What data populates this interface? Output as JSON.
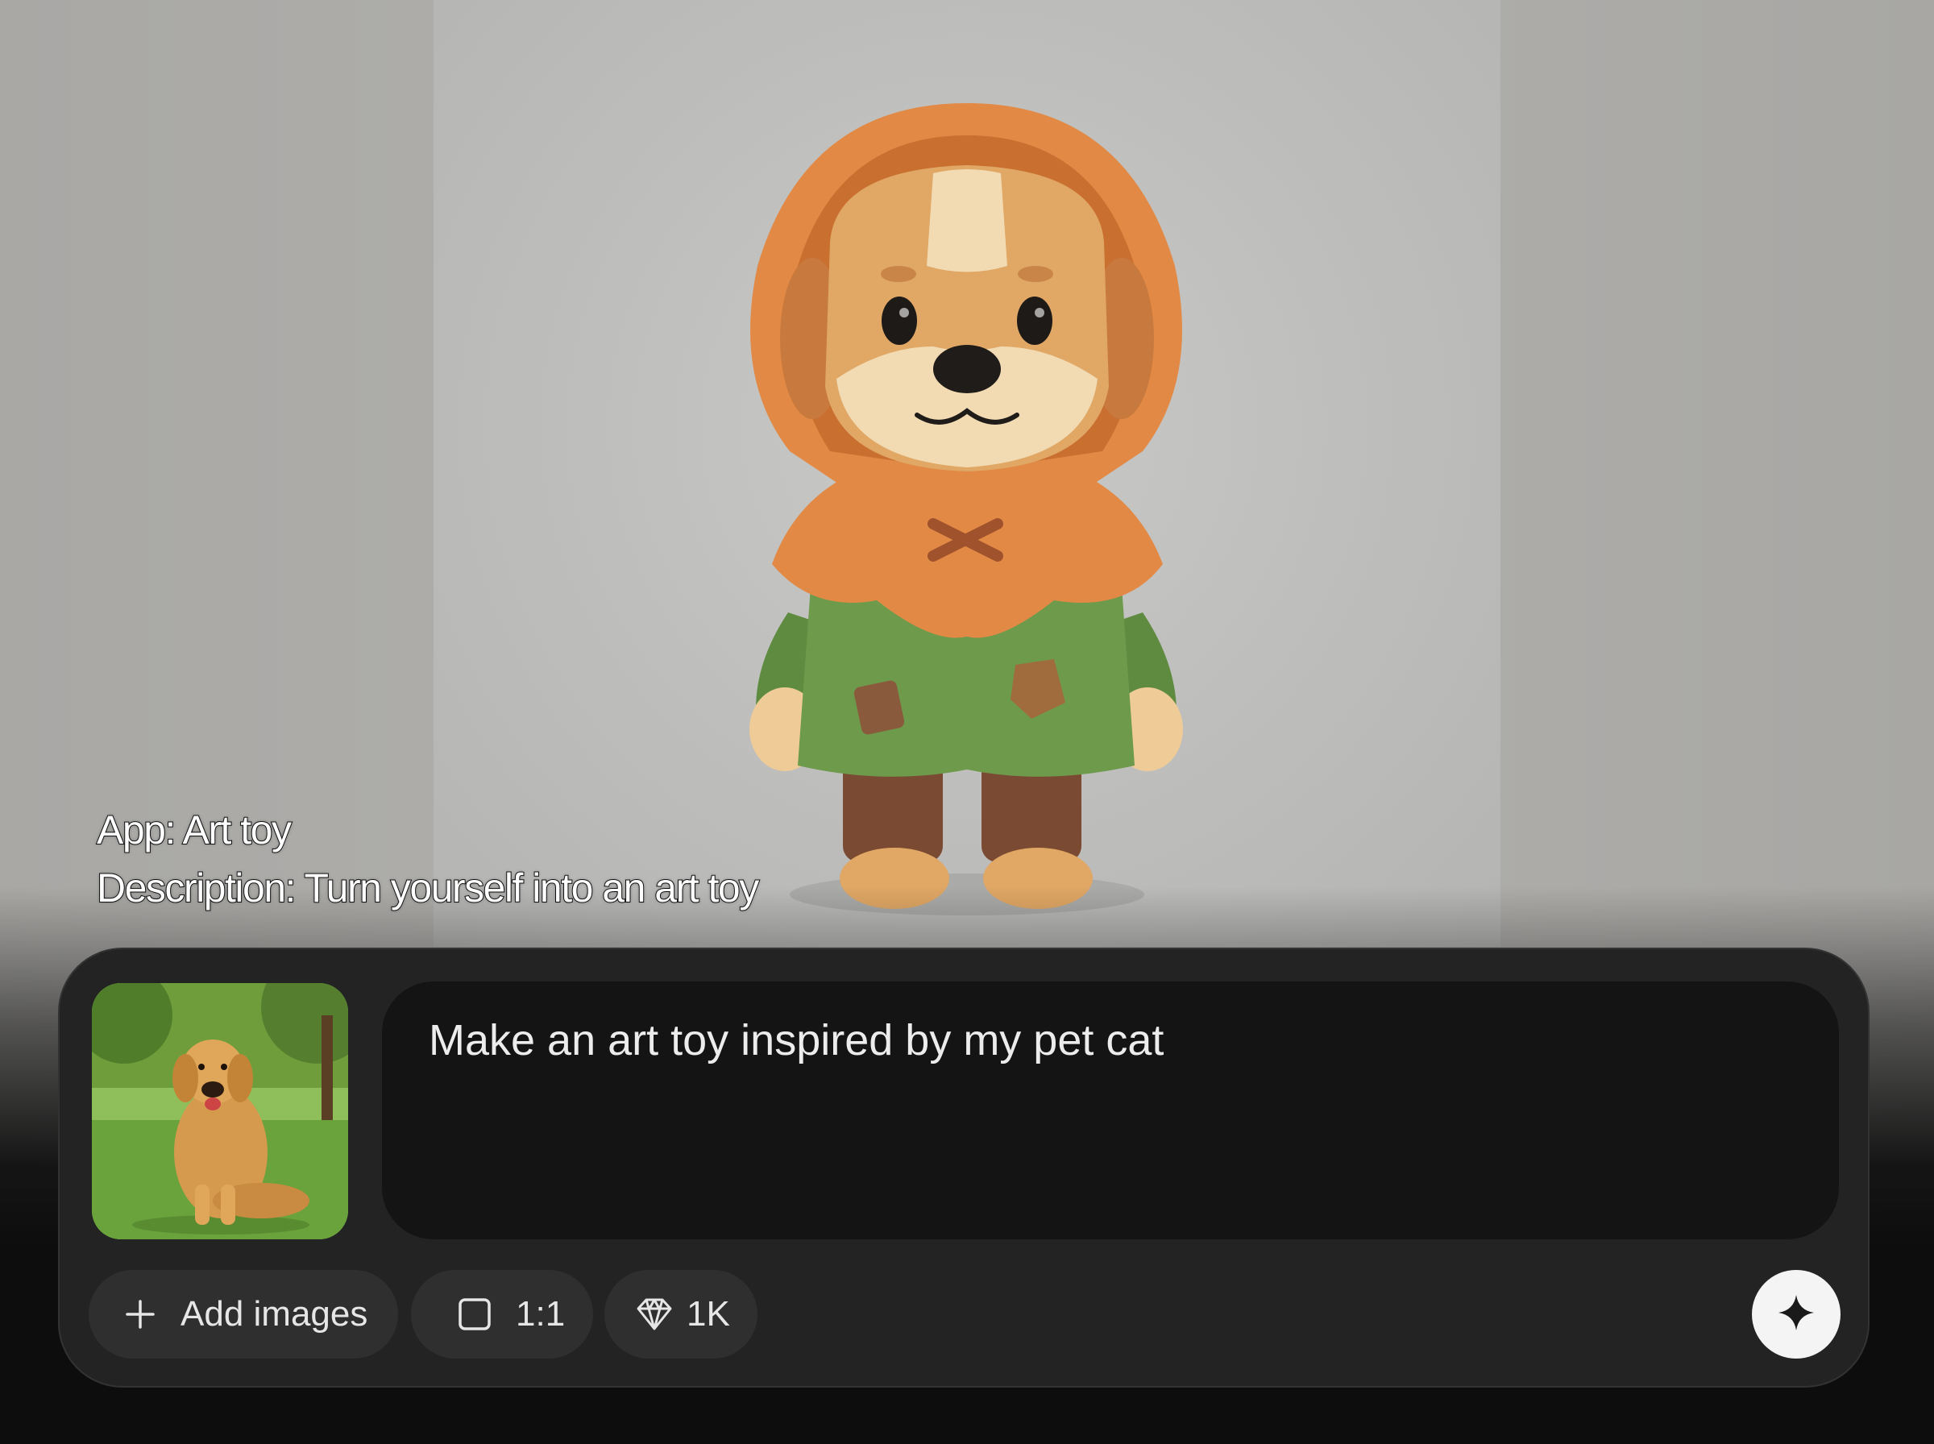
{
  "caption": {
    "app_line": "App: Art toy",
    "description_line": "Description: Turn yourself into an art toy"
  },
  "hero": {
    "subject": "art toy dog in orange hood and green tunic"
  },
  "reference_thumbnail": {
    "subject": "golden retriever sitting on grass"
  },
  "prompt": {
    "value": "Make an art toy inspired by my pet cat"
  },
  "toolbar": {
    "add_images_label": "Add images",
    "aspect_ratio_label": "1:1",
    "resolution_label": "1K",
    "icons": [
      "plus-icon",
      "square-icon",
      "diamond-icon",
      "sparkle-icon"
    ]
  },
  "colors": {
    "panel": "#232323",
    "prompt_bg": "#141414",
    "pill": "#2f2f2f",
    "send_button": "#f4f4f4",
    "hood": "#e28a45",
    "tunic": "#6e9a4c"
  }
}
